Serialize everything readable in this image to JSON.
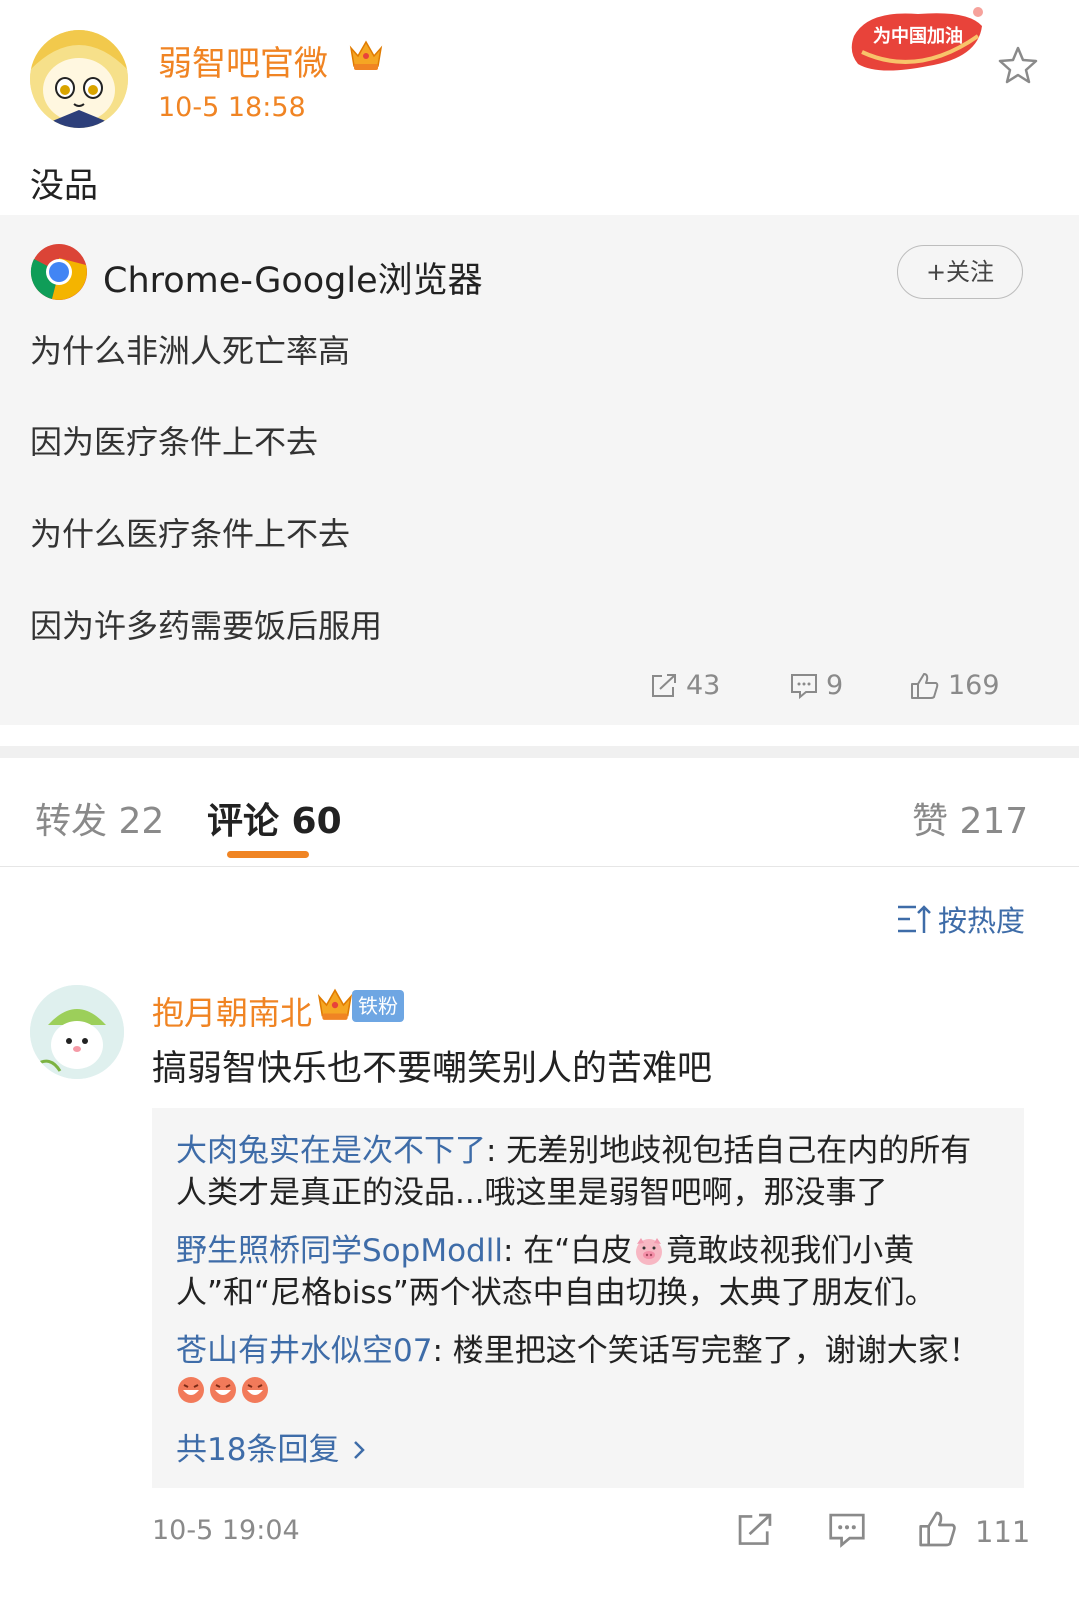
{
  "post": {
    "author": "弱智吧官微",
    "time": "10-5 18:58",
    "text": "没品",
    "badge_text": "为中国加油"
  },
  "repost": {
    "author": "Chrome-Google浏览器",
    "follow_label": "+关注",
    "lines": [
      "为什么非洲人死亡率高",
      "因为医疗条件上不去",
      "为什么医疗条件上不去",
      "因为许多药需要饭后服用"
    ],
    "forwards": "43",
    "comments": "9",
    "likes": "169"
  },
  "tabs": {
    "forward": "转发 22",
    "comment": "评论 60",
    "like": "赞 217"
  },
  "sort_label": "按热度",
  "comment": {
    "author": "抱月朝南北",
    "fan_badge": "铁粉",
    "text": "搞弱智快乐也不要嘲笑别人的苦难吧",
    "replies": [
      {
        "user": "大肉兔实在是次不下了",
        "text": ": 无差别地歧视包括自己在内的所有人类才是真正的没品...哦这里是弱智吧啊，那没事了"
      },
      {
        "user": "野生照桥同学SopModll",
        "text_before": ": 在“白皮",
        "text_after": "竟敢歧视我们小黄人”和“尼格biss”两个状态中自由切换，太典了朋友们。"
      },
      {
        "user": "苍山有井水似空07",
        "text": ": 楼里把这个笑话写完整了，谢谢大家！"
      }
    ],
    "more_replies": "共18条回复",
    "time": "10-5 19:04",
    "likes": "111"
  },
  "colors": {
    "accent": "#f08423",
    "link": "#3e6ca8",
    "muted": "#8a8a8a",
    "card_bg": "#f5f5f5"
  }
}
